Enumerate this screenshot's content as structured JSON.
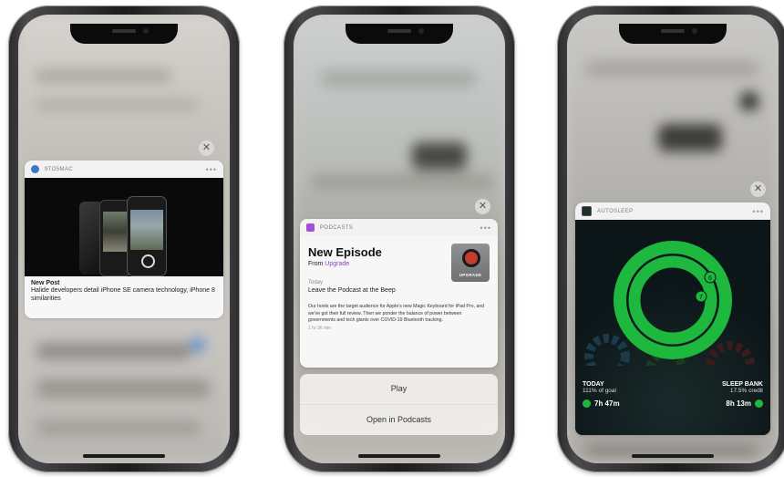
{
  "phones": [
    {
      "notification": {
        "app_name": "9TO5MAC",
        "title": "New Post",
        "body": "Halide developers detail iPhone SE camera technology, iPhone 8 similarities",
        "more": "•••",
        "close": "✕"
      }
    },
    {
      "notification": {
        "app_name": "PODCASTS",
        "title": "New Episode",
        "from_label": "From ",
        "from_link": "Upgrade",
        "artwork_label": "UPGRADE",
        "date": "Today",
        "episode_title": "Leave the Podcast at the Beep",
        "description": "Our hosts are the target audience for Apple's new Magic Keyboard for iPad Pro, and we've got their full review. Then we ponder the balance of power between governments and tech giants over COVID-19 Bluetooth tracking.",
        "duration": "1 hr 36 min",
        "more": "•••",
        "close": "✕"
      },
      "actions": [
        "Play",
        "Open in Podcasts"
      ]
    },
    {
      "notification": {
        "app_name": "AUTOSLEEP",
        "more": "•••",
        "close": "✕",
        "today_label": "TODAY",
        "today_value": "111% of goal",
        "today_time": "7h 47m",
        "bank_label": "SLEEP BANK",
        "bank_value": "17.5% credit",
        "bank_time": "8h 13m",
        "ring_marks": [
          "6",
          "7"
        ]
      }
    }
  ],
  "colors": {
    "ring_green": "#1fb83f",
    "podcasts_purple": "#a24fd9",
    "link_purple": "#8e44c9",
    "autosleep_bg": "#0c1518"
  }
}
